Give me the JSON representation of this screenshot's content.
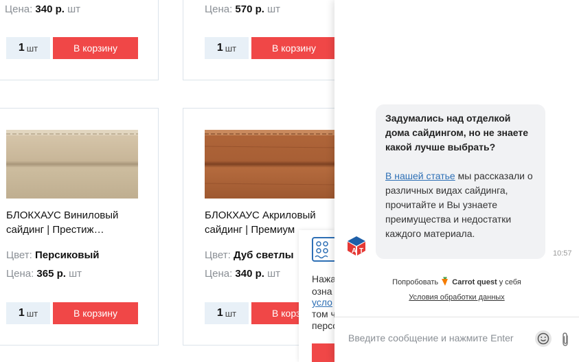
{
  "products": [
    {
      "price_label": "Цена:",
      "price": "340 р.",
      "unit": "шт",
      "qty": "1",
      "qty_unit": "шт",
      "cart_label": "В корзину"
    },
    {
      "price_label": "Цена:",
      "price": "570 р.",
      "unit": "шт",
      "qty": "1",
      "qty_unit": "шт",
      "cart_label": "В корзину"
    },
    {
      "title_line1": "БЛОКХАУС Виниловый",
      "title_line2": "сайдинг | Престиж…",
      "color_label": "Цвет:",
      "color": "Персиковый",
      "price_label": "Цена:",
      "price": "365 р.",
      "unit": "шт",
      "qty": "1",
      "qty_unit": "шт",
      "cart_label": "В корзину"
    },
    {
      "title_line1": "БЛОКХАУС Акриловый",
      "title_line2": "сайдинг | Премиум",
      "color_label": "Цвет:",
      "color": "Дуб светлы",
      "price_label": "Цена:",
      "price": "340 р.",
      "unit": "шт",
      "qty": "1",
      "qty_unit": "шт",
      "cart_label": "В корзину"
    }
  ],
  "popup": {
    "lines": [
      "Нажа",
      "озна",
      "усло",
      "том ч",
      "персо"
    ]
  },
  "chat": {
    "question": "Задумались над отделкой дома сайдингом, но не знаете какой лучше выбрать?",
    "link_text": "В нашей статье",
    "body_text": " мы рассказали о различных видах сайдинга, прочитайте и Вы узнаете преимущества и недостатки каждого материала.",
    "time": "10:57",
    "powered_prefix": "Попробовать",
    "powered_brand": "Carrot quest",
    "powered_suffix": "у себя",
    "terms": "Условия обработки данных",
    "input_placeholder": "Введите сообщение и нажмите Enter"
  },
  "colors": {
    "accent": "#f04747",
    "qty_bg": "#e8f0f7",
    "link": "#2d6fb5"
  }
}
